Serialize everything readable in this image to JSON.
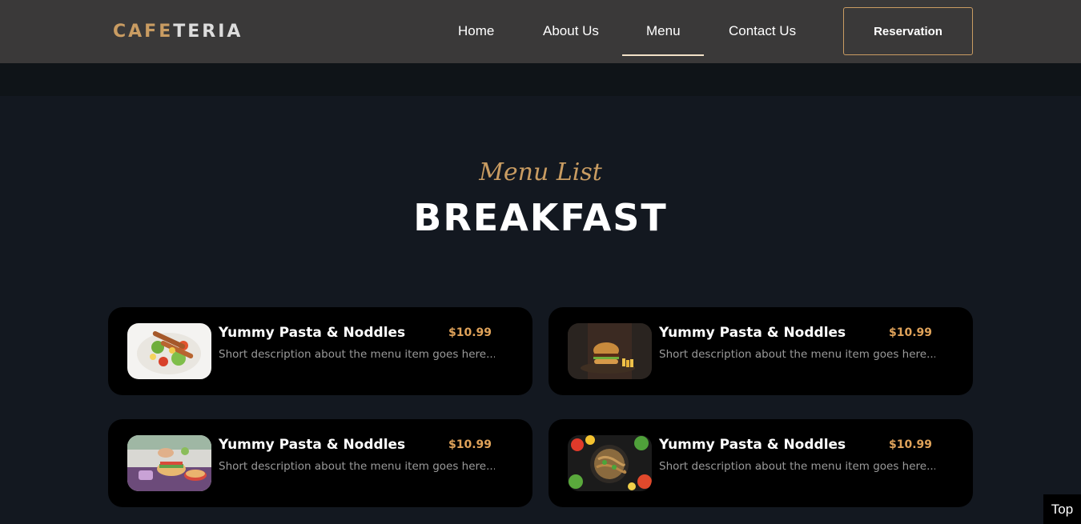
{
  "brand": {
    "logo_accent": "CAFE",
    "logo_rest": "TERIA"
  },
  "nav": {
    "links": [
      "Home",
      "About Us",
      "Menu",
      "Contact Us"
    ],
    "active": "Menu",
    "reservation_label": "Reservation"
  },
  "menu_section": {
    "subtitle": "Menu List",
    "title": "BREAKFAST",
    "items": [
      {
        "name": "Yummy Pasta & Noddles",
        "price": "$10.99",
        "description": "Short description about the menu item goes here...",
        "image_icon": "kebab-salad-image"
      },
      {
        "name": "Yummy Pasta & Noddles",
        "price": "$10.99",
        "description": "Short description about the menu item goes here...",
        "image_icon": "burger-image"
      },
      {
        "name": "Yummy Pasta & Noddles",
        "price": "$10.99",
        "description": "Short description about the menu item goes here...",
        "image_icon": "sandwich-prep-image"
      },
      {
        "name": "Yummy Pasta & Noddles",
        "price": "$10.99",
        "description": "Short description about the menu item goes here...",
        "image_icon": "noodle-bowl-image"
      }
    ]
  },
  "back_to_top_label": "Top",
  "colors": {
    "accent": "#c99c62",
    "price": "#e0a35a",
    "navbar": "#3a3939",
    "background": "#131820",
    "card": "#000000"
  }
}
